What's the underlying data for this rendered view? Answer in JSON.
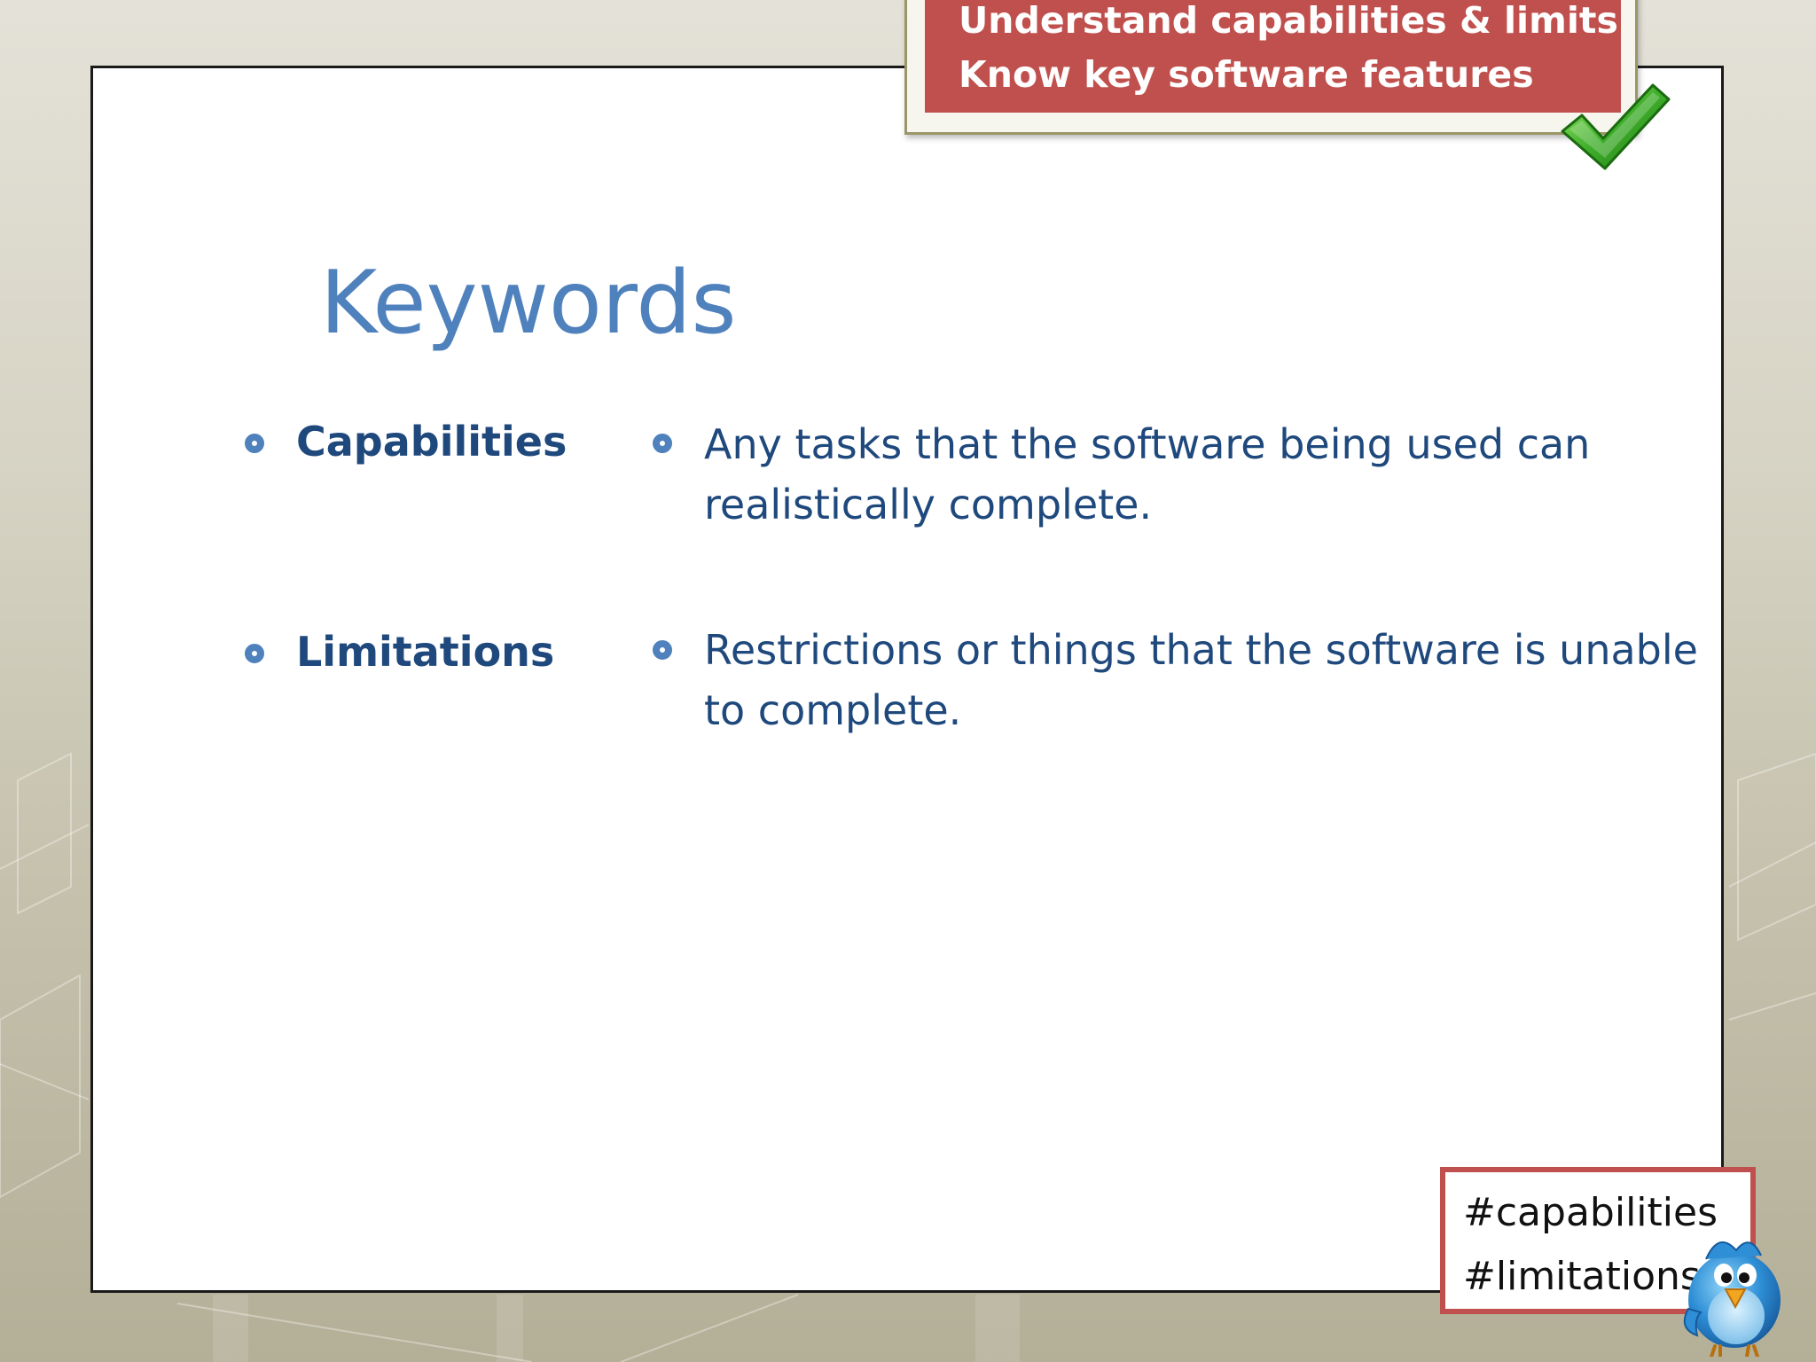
{
  "objectives": {
    "line1": "Understand capabilities & limits",
    "line2": "Know key software features"
  },
  "title": "Keywords",
  "keywords": [
    {
      "term": "Capabilities",
      "definition": "Any tasks that the software being used can realistically complete."
    },
    {
      "term": "Limitations",
      "definition": "Restrictions or things that the software is unable to complete."
    }
  ],
  "hashtags": {
    "tag1": "#capabilities",
    "tag2": "#limitations"
  },
  "icons": {
    "objective": "green-checkmark-icon",
    "mascot": "blue-bird-icon",
    "bullet": "ring-bullet-icon"
  },
  "colors": {
    "title": "#4f81bd",
    "text": "#1f497d",
    "objective_fill": "#c0504d",
    "hashtag_border": "#c0504d",
    "bullet": "#4f81bd"
  }
}
